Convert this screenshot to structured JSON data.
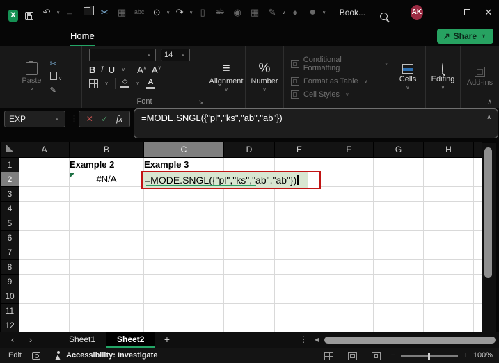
{
  "icons": {
    "chevron_down": "∨",
    "chevron_up": "∧",
    "undo": "↶",
    "redo": "↷",
    "back": "←",
    "cut": "✂",
    "paste_special": "▦",
    "spelling": "abc",
    "touch": "⊙",
    "new_file": "▯",
    "strike": "ab",
    "camera": "◉",
    "table_camera": "▦",
    "draw": "✎",
    "record": "●",
    "share_arrow": "↗",
    "minimize": "—",
    "close": "✕",
    "cancel": "✕",
    "enter": "✓",
    "fx": "fx",
    "dots_vertical": "⋮",
    "prev": "‹",
    "next": "›",
    "add": "+",
    "left_triangle": "◀",
    "minus": "−",
    "plus": "+",
    "align": "≡",
    "percent": "%",
    "dialog_launcher": "↘",
    "excel_logo": "X"
  },
  "titlebar": {
    "title": "Book...",
    "avatar_initials": "AK"
  },
  "ribbon": {
    "active_tab": "Home",
    "share_label": "Share",
    "clipboard": {
      "paste_label": "Paste"
    },
    "font": {
      "group_label": "Font",
      "font_name_value": "",
      "font_size_value": "14",
      "bold": "B",
      "italic": "I",
      "underline": "U",
      "grow_font": "A",
      "shrink_font": "A",
      "font_color": "A"
    },
    "alignment_label": "Alignment",
    "number_label": "Number",
    "styles": {
      "conditional_formatting": "Conditional Formatting",
      "format_as_table": "Format as Table",
      "cell_styles": "Cell Styles"
    },
    "cells_label": "Cells",
    "editing_label": "Editing",
    "addins_label": "Add-ins"
  },
  "formula_bar": {
    "name_box_value": "EXP",
    "formula": "=MODE.SNGL({\"pl\",\"ks\",\"ab\",\"ab\"})"
  },
  "grid": {
    "column_headers": [
      "A",
      "B",
      "C",
      "D",
      "E",
      "F",
      "G",
      "H"
    ],
    "row_headers": [
      "1",
      "2",
      "3",
      "4",
      "5",
      "6",
      "7",
      "8",
      "9",
      "10",
      "11",
      "12"
    ],
    "active_column": "C",
    "active_row": "2",
    "cells": {
      "B1": "Example 2",
      "C1": "Example 3",
      "B2": "#N/A",
      "C2": "=MODE.SNGL({\"pl\",\"ks\",\"ab\",\"ab\"})"
    },
    "colors": {
      "header_fill": "#ED7D31",
      "value_fill": "#D8E6D1",
      "edit_border": "#C11414"
    }
  },
  "sheet_tabs": {
    "tabs": [
      {
        "label": "Sheet1",
        "active": false
      },
      {
        "label": "Sheet2",
        "active": true
      }
    ]
  },
  "status_bar": {
    "mode": "Edit",
    "accessibility": "Accessibility: Investigate",
    "zoom_level": "100%"
  }
}
